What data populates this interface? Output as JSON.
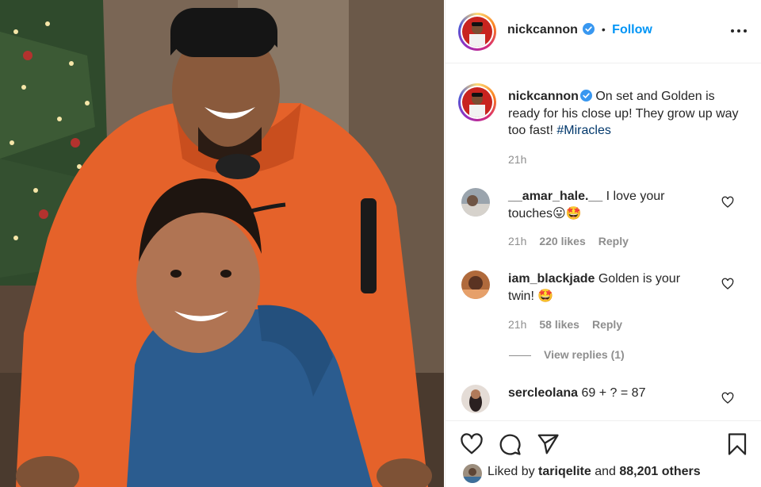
{
  "post": {
    "username": "nickcannon",
    "follow_label": "Follow",
    "dot": "•",
    "caption": "On set and Golden is ready for his close up! They grow up way too fast!",
    "hashtag": "#Miracles",
    "time": "21h"
  },
  "comments": [
    {
      "username": "__amar_hale.__",
      "text_line1": "I love your",
      "text_line2": "touches😛🤩",
      "time": "21h",
      "likes": "220 likes",
      "reply_label": "Reply"
    },
    {
      "username": "iam_blackjade",
      "text_line1": "Golden is your",
      "text_line2": "twin! 🤩",
      "time": "21h",
      "likes": "58 likes",
      "reply_label": "Reply",
      "view_replies": "View replies (1)"
    },
    {
      "username": "sercleolana",
      "text_line1": "69 + ? = 87"
    }
  ],
  "liked_by": {
    "prefix": "Liked by",
    "user": "tariqelite",
    "middle": "and",
    "others": "88,201 others"
  },
  "colors": {
    "link": "#0095f6",
    "hashtag": "#00376b",
    "muted": "#8e8e8e",
    "text": "#262626"
  },
  "icons": [
    "heart-icon",
    "comment-icon",
    "share-icon",
    "bookmark-icon",
    "more-options-icon",
    "verified-badge-icon"
  ]
}
